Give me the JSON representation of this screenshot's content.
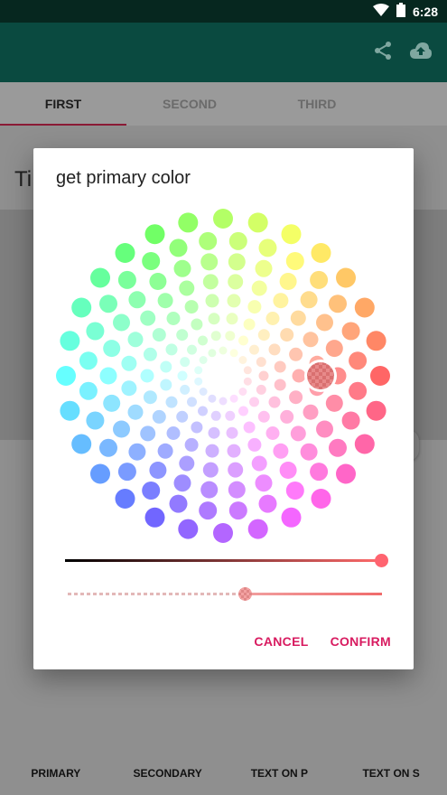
{
  "status": {
    "time": "6:28"
  },
  "tabs": [
    {
      "label": "FIRST",
      "active": true
    },
    {
      "label": "SECOND",
      "active": false
    },
    {
      "label": "THIRD",
      "active": false
    }
  ],
  "background": {
    "title_fragment": "Ti"
  },
  "dialog": {
    "title": "get primary color",
    "cancel": "CANCEL",
    "confirm": "CONFIRM",
    "selected_color": "#ff6b6b",
    "lightness_value": 1.0,
    "alpha_value": 0.56
  },
  "bottom_bar": [
    "PRIMARY",
    "SECONDARY",
    "TEXT ON P",
    "TEXT ON S"
  ],
  "colors": {
    "app_bar": "#0a4a40",
    "status_bar": "#06271f",
    "accent": "#d81b60",
    "tab_indicator": "#8a1a35"
  },
  "icons": [
    "share-icon",
    "cloud-upload-icon",
    "wifi-icon",
    "battery-icon"
  ]
}
